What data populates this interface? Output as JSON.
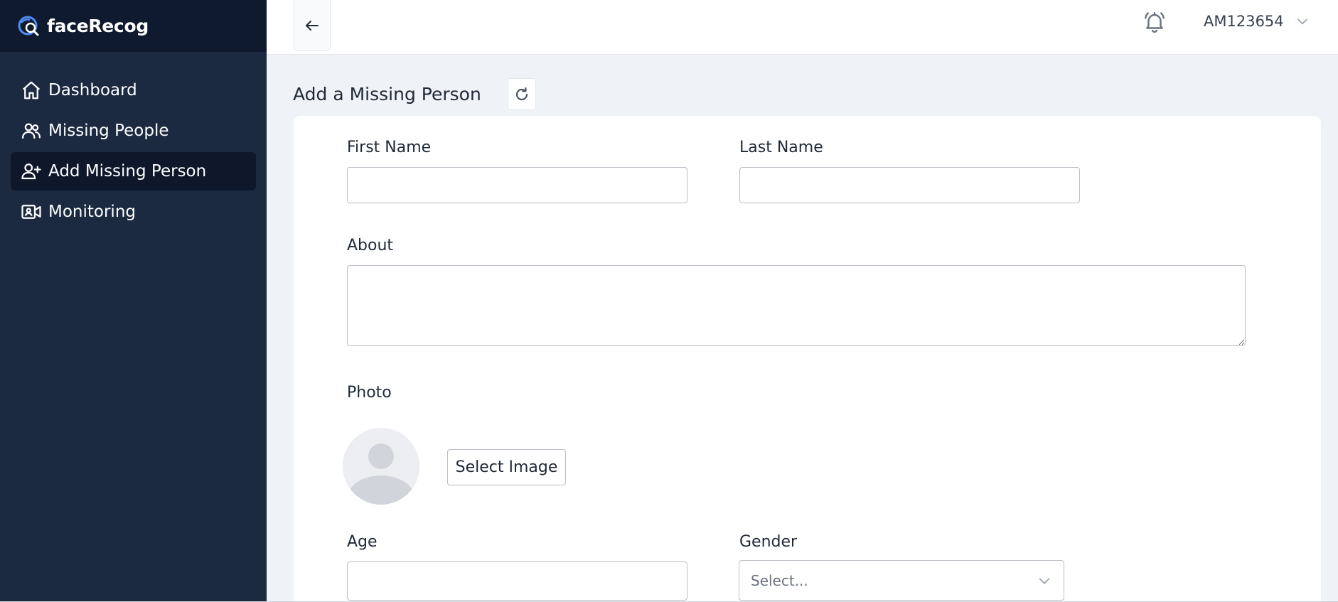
{
  "app": {
    "brand": "faceRecog"
  },
  "sidebar": {
    "items": [
      {
        "label": "Dashboard",
        "icon": "home-icon",
        "active": false
      },
      {
        "label": "Missing People",
        "icon": "users-icon",
        "active": false
      },
      {
        "label": "Add Missing Person",
        "icon": "user-plus-icon",
        "active": true
      },
      {
        "label": "Monitoring",
        "icon": "video-camera-icon",
        "active": false
      }
    ]
  },
  "topbar": {
    "user_id": "AM123654"
  },
  "page": {
    "title": "Add a Missing Person"
  },
  "form": {
    "first_name": {
      "label": "First Name",
      "value": ""
    },
    "last_name": {
      "label": "Last Name",
      "value": ""
    },
    "about": {
      "label": "About",
      "value": ""
    },
    "photo": {
      "label": "Photo",
      "button": "Select Image"
    },
    "age": {
      "label": "Age",
      "value": ""
    },
    "gender": {
      "label": "Gender",
      "placeholder": "Select..."
    }
  },
  "colors": {
    "sidebar": "#1b2941",
    "sidebar_header": "#0f1a2e",
    "active_item": "#0f172a",
    "main_bg": "#eff3f7",
    "logo_accent": "#4f8df5"
  }
}
